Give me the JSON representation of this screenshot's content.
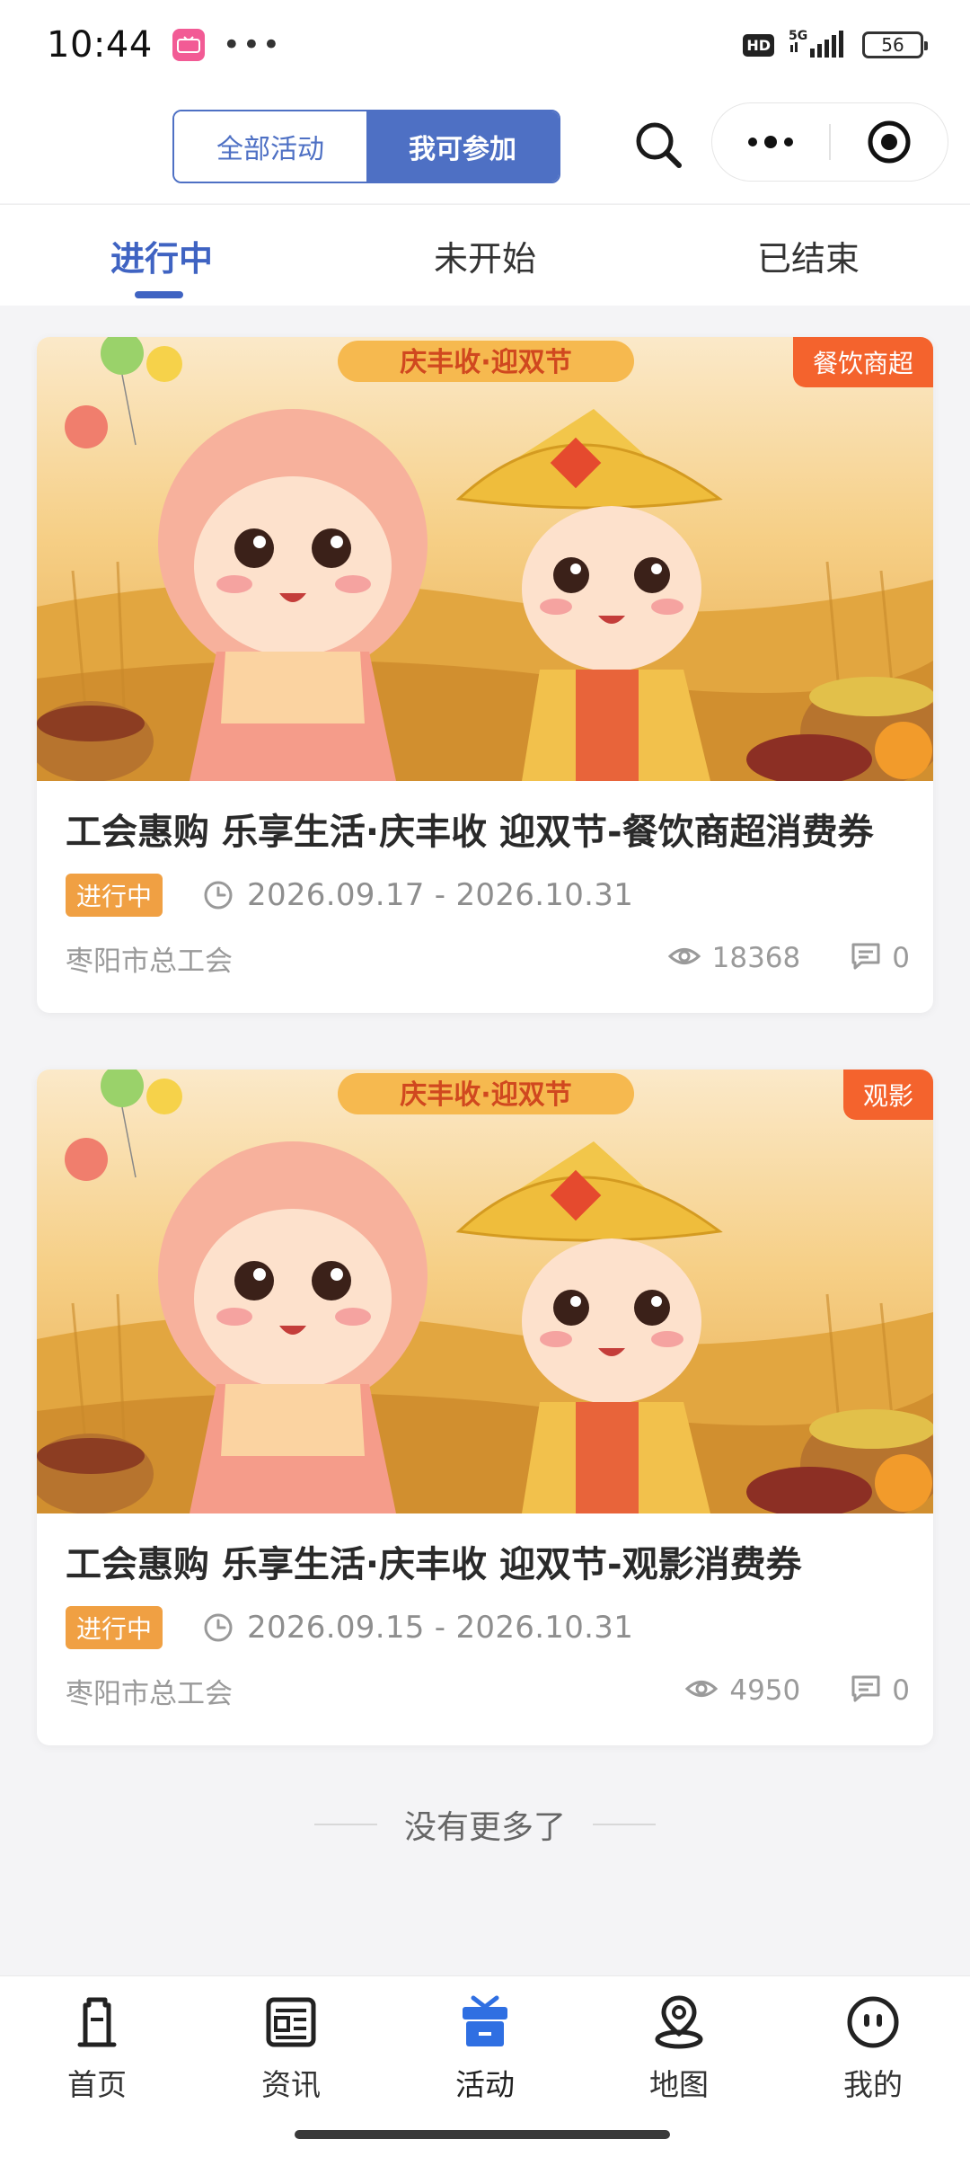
{
  "status_bar": {
    "time": "10:44",
    "more": "•••",
    "hd": "HD",
    "network": "5G",
    "battery": "56"
  },
  "header": {
    "segment": {
      "options": [
        "全部活动",
        "我可参加"
      ],
      "selected": "我可参加"
    },
    "icons": [
      "search-icon",
      "more-icon",
      "close-target-icon"
    ]
  },
  "tabs": {
    "items": [
      "进行中",
      "未开始",
      "已结束"
    ],
    "active": "进行中"
  },
  "activities": [
    {
      "corner_tag": "餐饮商超",
      "banner_text": "庆丰收·迎双节",
      "title": "工会惠购 乐享生活·庆丰收 迎双节-餐饮商超消费券",
      "status": "进行中",
      "date_range": "2026.09.17 - 2026.10.31",
      "organizer": "枣阳市总工会",
      "views": "18368",
      "comments": "0"
    },
    {
      "corner_tag": "观影",
      "banner_text": "庆丰收·迎双节",
      "title": "工会惠购 乐享生活·庆丰收 迎双节-观影消费券",
      "status": "进行中",
      "date_range": "2026.09.15 - 2026.10.31",
      "organizer": "枣阳市总工会",
      "views": "4950",
      "comments": "0"
    }
  ],
  "list_end_text": "没有更多了",
  "bottom_nav": {
    "items": [
      {
        "label": "首页",
        "icon": "home-icon"
      },
      {
        "label": "资讯",
        "icon": "news-icon"
      },
      {
        "label": "活动",
        "icon": "gift-icon"
      },
      {
        "label": "地图",
        "icon": "map-pin-icon"
      },
      {
        "label": "我的",
        "icon": "profile-icon"
      }
    ],
    "active": "活动"
  },
  "colors": {
    "accent": "#3f63c2",
    "segment_blue": "#4e70c4",
    "corner_tag": "#f4632d",
    "status_tag": "#f0a043"
  }
}
